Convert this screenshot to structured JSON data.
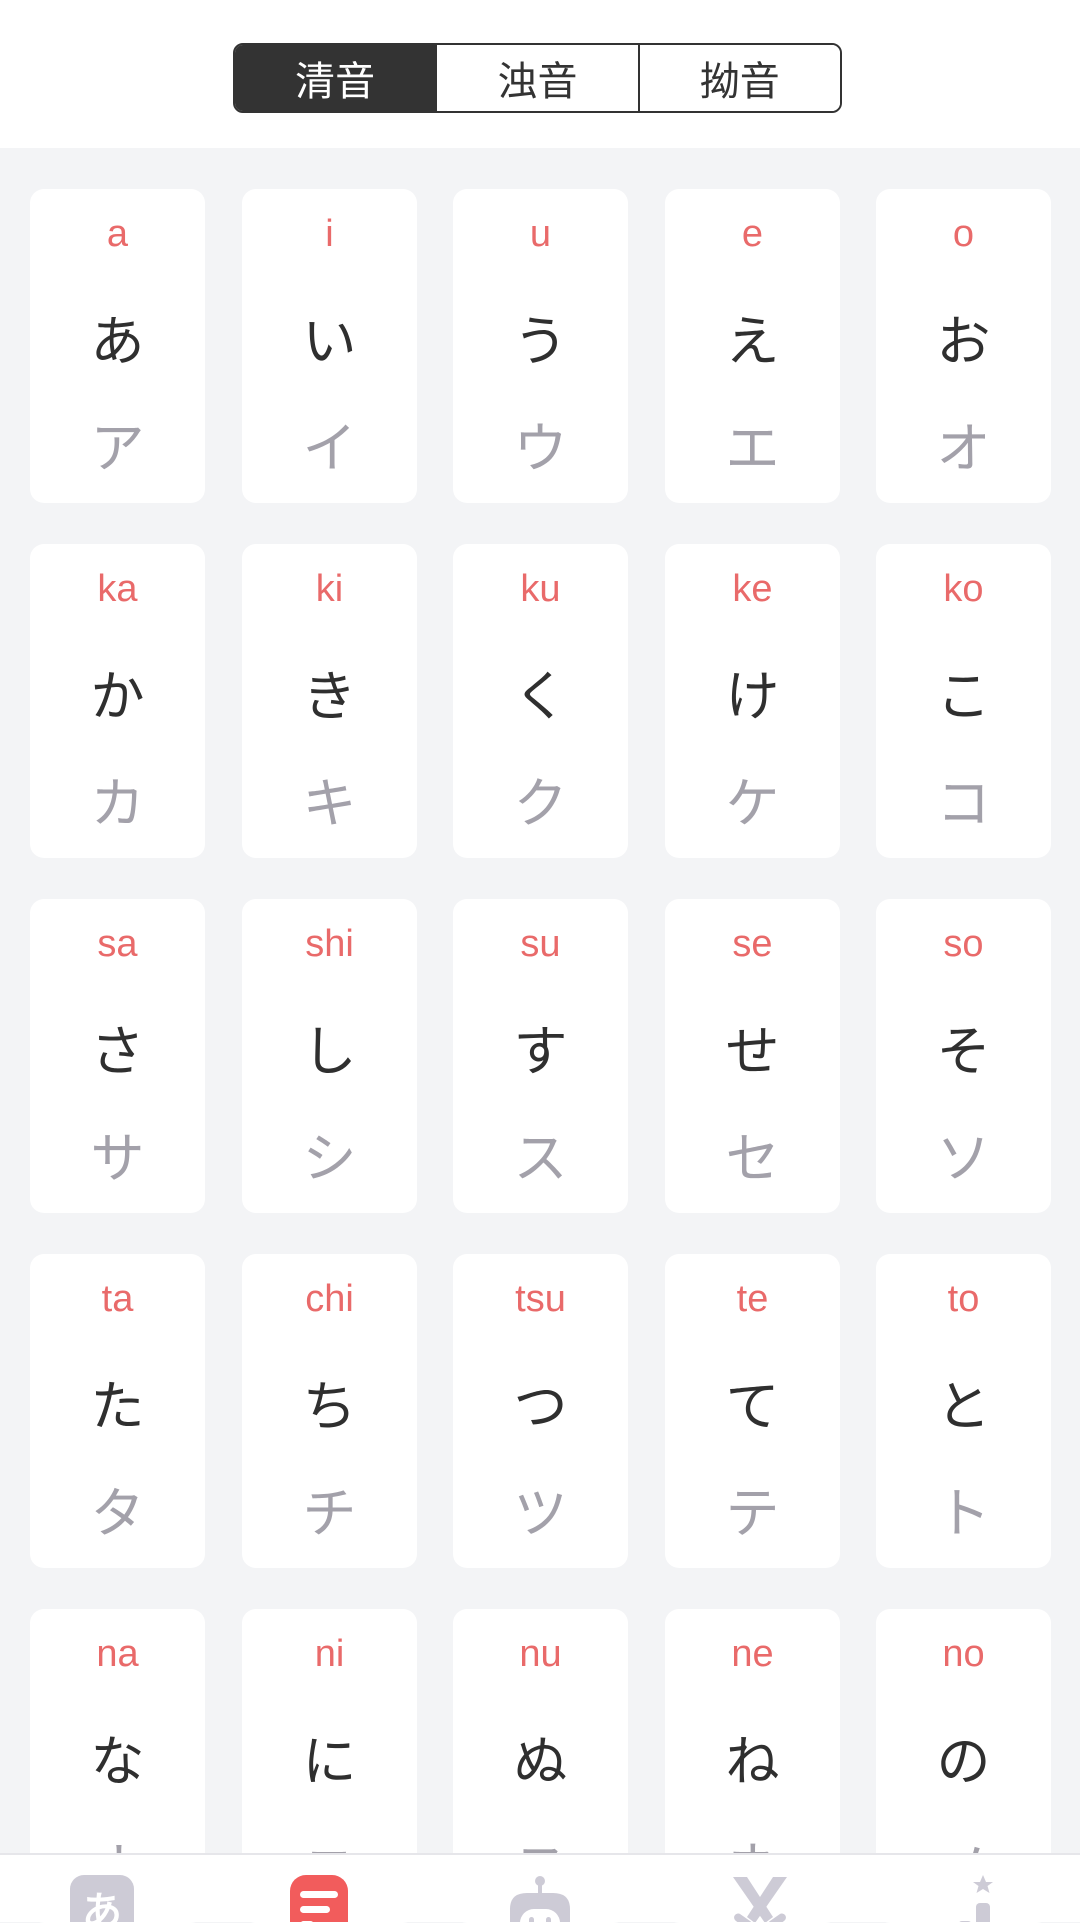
{
  "tabs": [
    {
      "label": "清音",
      "active": true
    },
    {
      "label": "浊音",
      "active": false
    },
    {
      "label": "拗音",
      "active": false
    }
  ],
  "kana": [
    {
      "romaji": "a",
      "hiragana": "あ",
      "katakana": "ア"
    },
    {
      "romaji": "i",
      "hiragana": "い",
      "katakana": "イ"
    },
    {
      "romaji": "u",
      "hiragana": "う",
      "katakana": "ウ"
    },
    {
      "romaji": "e",
      "hiragana": "え",
      "katakana": "エ"
    },
    {
      "romaji": "o",
      "hiragana": "お",
      "katakana": "オ"
    },
    {
      "romaji": "ka",
      "hiragana": "か",
      "katakana": "カ"
    },
    {
      "romaji": "ki",
      "hiragana": "き",
      "katakana": "キ"
    },
    {
      "romaji": "ku",
      "hiragana": "く",
      "katakana": "ク"
    },
    {
      "romaji": "ke",
      "hiragana": "け",
      "katakana": "ケ"
    },
    {
      "romaji": "ko",
      "hiragana": "こ",
      "katakana": "コ"
    },
    {
      "romaji": "sa",
      "hiragana": "さ",
      "katakana": "サ"
    },
    {
      "romaji": "shi",
      "hiragana": "し",
      "katakana": "シ"
    },
    {
      "romaji": "su",
      "hiragana": "す",
      "katakana": "ス"
    },
    {
      "romaji": "se",
      "hiragana": "せ",
      "katakana": "セ"
    },
    {
      "romaji": "so",
      "hiragana": "そ",
      "katakana": "ソ"
    },
    {
      "romaji": "ta",
      "hiragana": "た",
      "katakana": "タ"
    },
    {
      "romaji": "chi",
      "hiragana": "ち",
      "katakana": "チ"
    },
    {
      "romaji": "tsu",
      "hiragana": "つ",
      "katakana": "ツ"
    },
    {
      "romaji": "te",
      "hiragana": "て",
      "katakana": "テ"
    },
    {
      "romaji": "to",
      "hiragana": "と",
      "katakana": "ト"
    },
    {
      "romaji": "na",
      "hiragana": "な",
      "katakana": "ナ"
    },
    {
      "romaji": "ni",
      "hiragana": "に",
      "katakana": "ニ"
    },
    {
      "romaji": "nu",
      "hiragana": "ぬ",
      "katakana": "ヌ"
    },
    {
      "romaji": "ne",
      "hiragana": "ね",
      "katakana": "ネ"
    },
    {
      "romaji": "no",
      "hiragana": "の",
      "katakana": "ノ"
    }
  ],
  "bottom_nav": [
    {
      "icon": "hiragana-icon",
      "glyph": "あ",
      "active": false
    },
    {
      "icon": "document-icon",
      "active": true
    },
    {
      "icon": "robot-icon",
      "active": false
    },
    {
      "icon": "crossed-swords-icon",
      "active": false
    },
    {
      "icon": "ranking-icon",
      "active": false
    }
  ],
  "colors": {
    "accent": "#f25c5c",
    "romaji": "#e96a6a",
    "inactive_icon": "#cdcbd6",
    "dark": "#333333"
  }
}
